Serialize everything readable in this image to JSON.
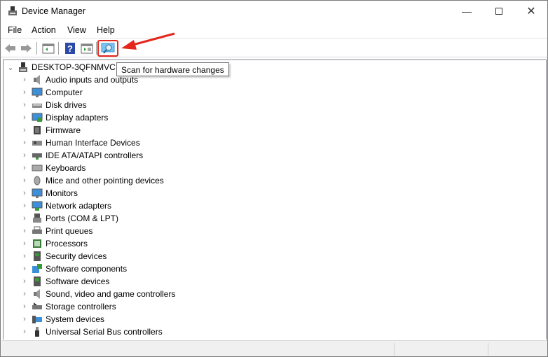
{
  "window": {
    "title": "Device Manager",
    "controls": [
      "minimize",
      "maximize",
      "close"
    ]
  },
  "menu": [
    "File",
    "Action",
    "View",
    "Help"
  ],
  "toolbar": {
    "buttons": [
      "back",
      "forward",
      "properties",
      "help",
      "update-driver",
      "scan-for-hardware-changes"
    ],
    "tooltip": "Scan for hardware changes"
  },
  "tree": {
    "root": "DESKTOP-3QFNMVC",
    "items": [
      {
        "label": "Audio inputs and outputs",
        "icon": "speaker-icon"
      },
      {
        "label": "Computer",
        "icon": "monitor-icon"
      },
      {
        "label": "Disk drives",
        "icon": "disk-icon"
      },
      {
        "label": "Display adapters",
        "icon": "display-adapter-icon"
      },
      {
        "label": "Firmware",
        "icon": "chip-icon"
      },
      {
        "label": "Human Interface Devices",
        "icon": "hid-icon"
      },
      {
        "label": "IDE ATA/ATAPI controllers",
        "icon": "ide-icon"
      },
      {
        "label": "Keyboards",
        "icon": "keyboard-icon"
      },
      {
        "label": "Mice and other pointing devices",
        "icon": "mouse-icon"
      },
      {
        "label": "Monitors",
        "icon": "monitor-icon"
      },
      {
        "label": "Network adapters",
        "icon": "network-icon"
      },
      {
        "label": "Ports (COM & LPT)",
        "icon": "port-icon"
      },
      {
        "label": "Print queues",
        "icon": "printer-icon"
      },
      {
        "label": "Processors",
        "icon": "processor-icon"
      },
      {
        "label": "Security devices",
        "icon": "security-icon"
      },
      {
        "label": "Software components",
        "icon": "software-component-icon"
      },
      {
        "label": "Software devices",
        "icon": "software-device-icon"
      },
      {
        "label": "Sound, video and game controllers",
        "icon": "speaker-icon"
      },
      {
        "label": "Storage controllers",
        "icon": "storage-icon"
      },
      {
        "label": "System devices",
        "icon": "system-icon"
      },
      {
        "label": "Universal Serial Bus controllers",
        "icon": "usb-icon"
      }
    ]
  },
  "colors": {
    "highlight": "#e5261c",
    "accent": "#3c8fd8"
  }
}
